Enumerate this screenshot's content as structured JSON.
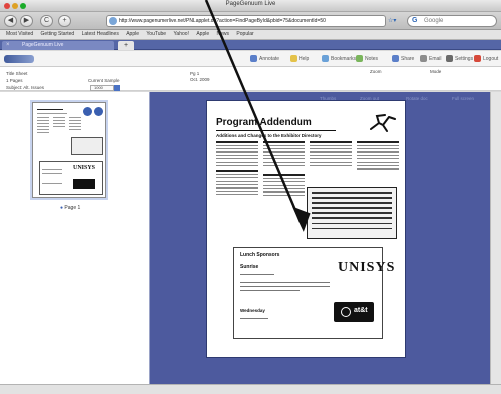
{
  "window": {
    "title": "PageGenuum Live"
  },
  "nav": {
    "back": "◀",
    "forward": "▶",
    "reload": "C",
    "home": "+",
    "url": "http://www.pagenumerlive.net/PNLapplet.do?action=FindPageById&pbid=75&documentId=50",
    "search_placeholder": "Google"
  },
  "bookmarks": [
    "Most Visited",
    "Getting Started",
    "Latest Headlines",
    "Apple",
    "YouTube",
    "Yahoo!",
    "Apple",
    "News",
    "Popular"
  ],
  "tab": {
    "label": "PageGenuum Live",
    "add": "+"
  },
  "toolbar": {
    "items": [
      {
        "label": "Annotate",
        "color": "#5b7fc9"
      },
      {
        "label": "Help",
        "color": "#e4c24a"
      },
      {
        "label": "Bookmarks",
        "color": "#6aa1d8"
      },
      {
        "label": "Notes",
        "color": "#7ab55c"
      },
      {
        "label": "Share",
        "color": "#5b7fc9"
      },
      {
        "label": "Email",
        "color": "#8c8c8c"
      },
      {
        "label": "Settings",
        "color": "#6a6a6a"
      },
      {
        "label": "Logout",
        "color": "#d6493a"
      }
    ]
  },
  "info": {
    "title_label": "Title Sheet",
    "pages_label": "1 Pages",
    "subject_label": "Subject: Alt. Issues",
    "current_sample_label": "Current Sample",
    "current_sample_value": "1000",
    "page_label": "Pg 1",
    "date_label": "Oct. 2009",
    "zoom_label": "Zoom",
    "mode_label": "Mode"
  },
  "thumbnail": {
    "label": "Page 1"
  },
  "right_tools": [
    "Thumbs",
    "Zoom out",
    "Rotate doc",
    "Full screen"
  ],
  "document": {
    "title": "Program Addendum",
    "subtitle": "Additions and Changes to the Exhibitor Directory",
    "lunch_heading": "Lunch Sponsors",
    "sunrise": "Sunrise",
    "wednesday": "Wednesday",
    "unisys": "UNISYS",
    "att": "at&t"
  },
  "colors": {
    "content_bg": "#4d5a9e",
    "tab_bar": "#5566a6"
  }
}
